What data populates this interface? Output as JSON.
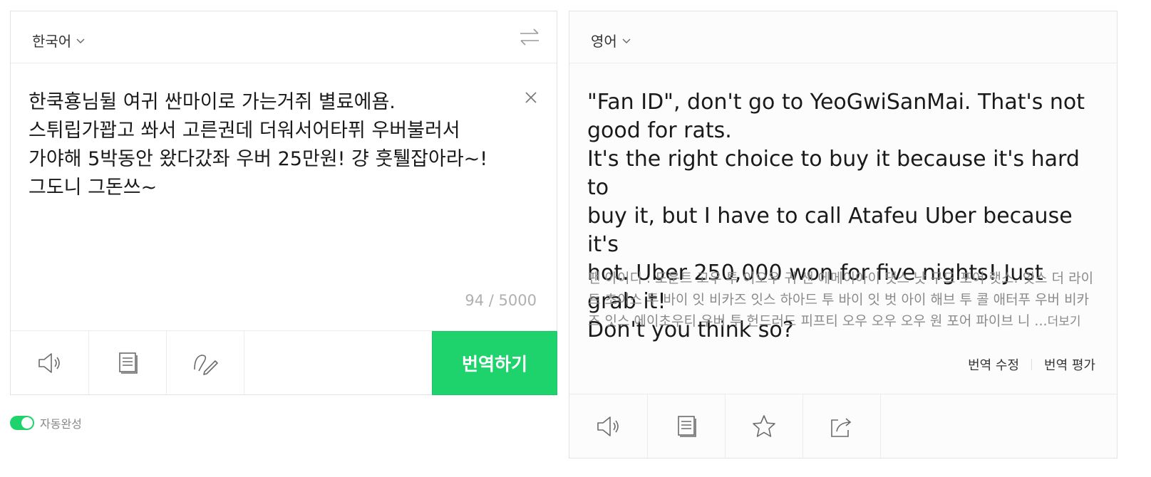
{
  "source": {
    "language": "한국어",
    "text": "한쿡횽님뒬 여귀 싼마이로 가는거쥐 별료에욤.\n스튀립가꽙고 쏴서 고른권데 더워서어타퓌 우버불러서\n가야해 5박동안 왔다갔좌 우버 25만원! 걍 훗퉬잡아라~!\n그도니 그돈쓰~",
    "counter": "94 / 5000",
    "translate_label": "번역하기",
    "tools": [
      "speaker-icon",
      "copy-icon",
      "handwriting-icon"
    ]
  },
  "autocomplete": {
    "label": "자동완성",
    "on": true
  },
  "target": {
    "language": "영어",
    "text": "\"Fan ID\", don't go to YeoGwiSanMai. That's not\ngood for rats.\nIt's the right choice to buy it because it's hard to\nbuy it, but I have to call Atafeu Uber because it's\nhot. Uber 250,000 won for five nights! Just grab it!\nDon't you think so?",
    "pronunciation": "팬 아이디 . 도운트 고우 투 이오우 귀 샌 에메이아이 댓스 낫 구드 포어 랫스. 잇스 더 라이트 초이스 투 바이 잇 비카즈 잇스 하아드 투 바이 잇 벗 아이 해브 투 콜 애터푸 우버 비카즈 잇스 에이초우티 우버 투 헌드러드 피프티 오우 오우 오우 원 포어 파이브 니 ...",
    "more_label": "더보기",
    "edit_label": "번역 수정",
    "rate_label": "번역 평가",
    "tools": [
      "speaker-icon",
      "copy-icon",
      "star-icon",
      "share-icon"
    ]
  },
  "colors": {
    "accent": "#1fd36c",
    "icon": "#6b6b6b"
  }
}
